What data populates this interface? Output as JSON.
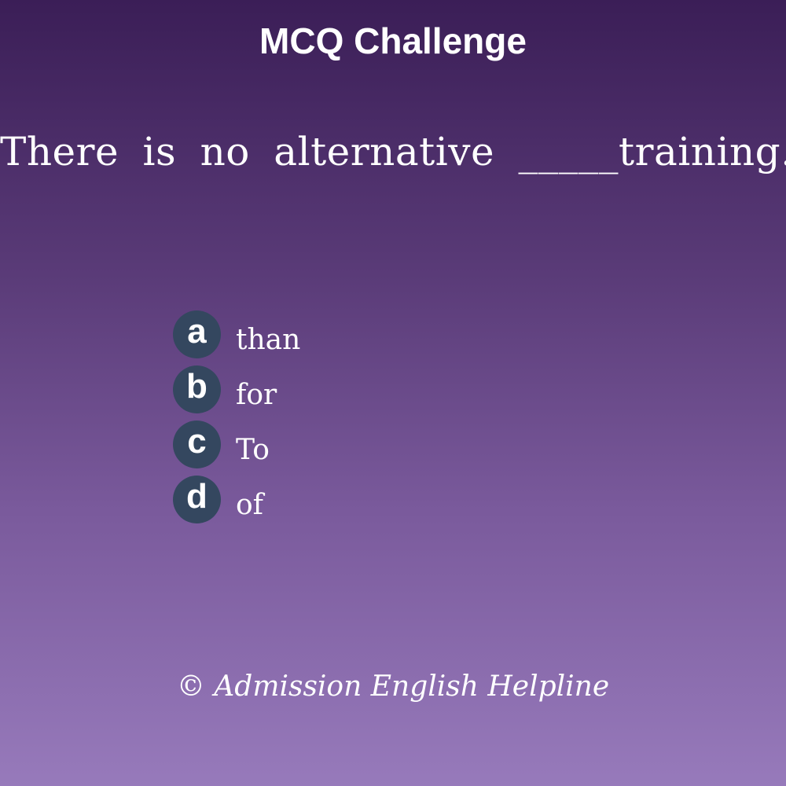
{
  "header": {
    "title": "MCQ Challenge"
  },
  "question": {
    "text": "There is no alternative _____training."
  },
  "options": [
    {
      "letter": "a",
      "text": "than"
    },
    {
      "letter": "b",
      "text": "for"
    },
    {
      "letter": "c",
      "text": "To"
    },
    {
      "letter": "d",
      "text": "of"
    }
  ],
  "footer": {
    "copyright": "© Admission English Helpline"
  },
  "colors": {
    "background_top": "#3b1e57",
    "background_bottom": "#977abb",
    "badge": "#34475f",
    "text": "#ffffff"
  }
}
